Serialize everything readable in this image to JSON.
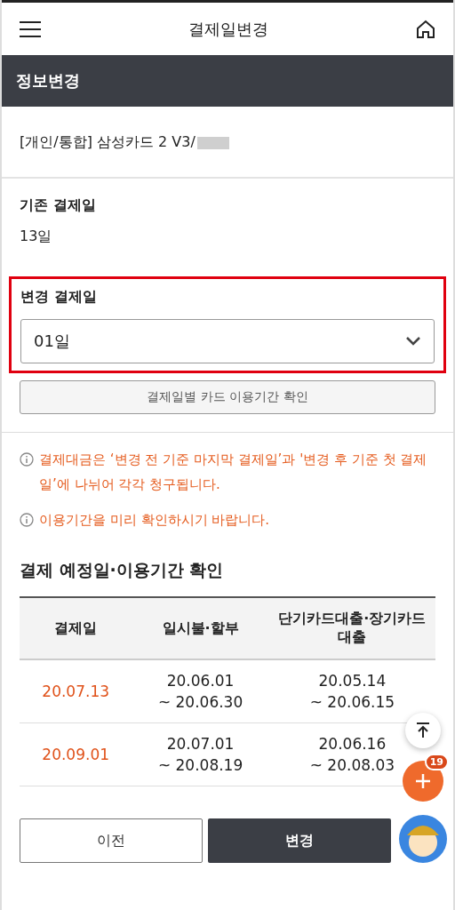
{
  "header": {
    "title": "결제일변경"
  },
  "section_bar": {
    "title": "정보변경"
  },
  "contract": {
    "value": "[개인/통합] 삼성카드 2 V3/"
  },
  "current_date": {
    "label": "기존 결제일",
    "value": "13일"
  },
  "new_date": {
    "label": "변경 결제일",
    "value": "01일",
    "highlighted": true
  },
  "check_button": "결제일별 카드 이용기간 확인",
  "notices": [
    "결제대금은 ‘변경 전 기준 마지막 결제일’과 '변경 후 기준 첫 결제일’에 나뉘어 각각 청구됩니다.",
    "이용기간을 미리 확인하시기 바랍니다."
  ],
  "schedule": {
    "title": "결제 예정일·이용기간 확인",
    "columns": [
      "결제일",
      "일시불·할부",
      "단기카드대출·장기카드대출"
    ],
    "rows": [
      [
        "20.07.13",
        "20.06.01\n~ 20.06.30",
        "20.05.14\n~ 20.06.15"
      ],
      [
        "20.09.01",
        "20.07.01\n~ 20.08.19",
        "20.06.16\n~ 20.08.03"
      ]
    ]
  },
  "buttons": {
    "prev": "이전",
    "submit": "변경"
  },
  "fab": {
    "badge": "19"
  }
}
